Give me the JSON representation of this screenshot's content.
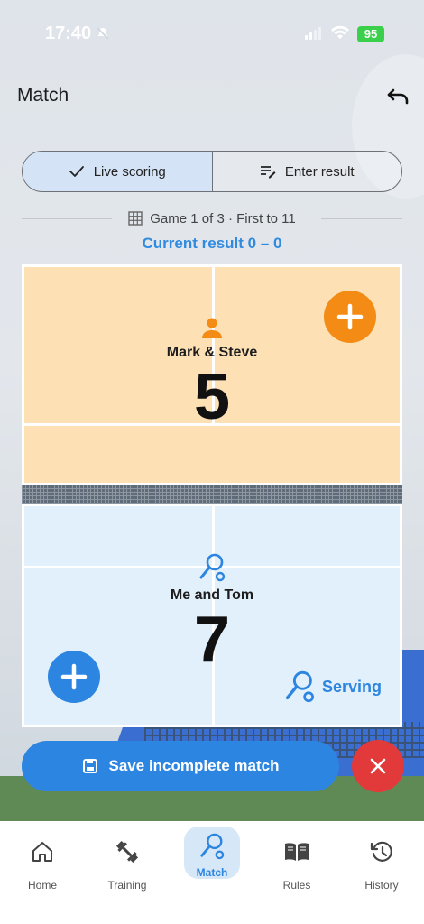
{
  "status": {
    "time": "17:40",
    "battery": "95"
  },
  "header": {
    "title": "Match"
  },
  "segment": {
    "live_label": "Live scoring",
    "enter_label": "Enter result"
  },
  "game": {
    "info": "Game 1 of 3 · First to 11",
    "current_result": "Current result 0 – 0"
  },
  "teams": {
    "top": {
      "name": "Mark & Steve",
      "score": "5"
    },
    "bottom": {
      "name": "Me and Tom",
      "score": "7",
      "serving_label": "Serving"
    }
  },
  "actions": {
    "save_label": "Save incomplete match"
  },
  "tabs": [
    {
      "label": "Home",
      "icon": "home-icon"
    },
    {
      "label": "Training",
      "icon": "dumbbell-icon"
    },
    {
      "label": "Match",
      "icon": "paddle-icon",
      "active": true
    },
    {
      "label": "Rules",
      "icon": "book-icon"
    },
    {
      "label": "History",
      "icon": "history-icon"
    }
  ],
  "colors": {
    "accent": "#2c85e0",
    "orange": "#f38b14",
    "danger": "#e23a3a",
    "top_court": "#fde0b4",
    "bottom_court": "#e2f0fb"
  }
}
